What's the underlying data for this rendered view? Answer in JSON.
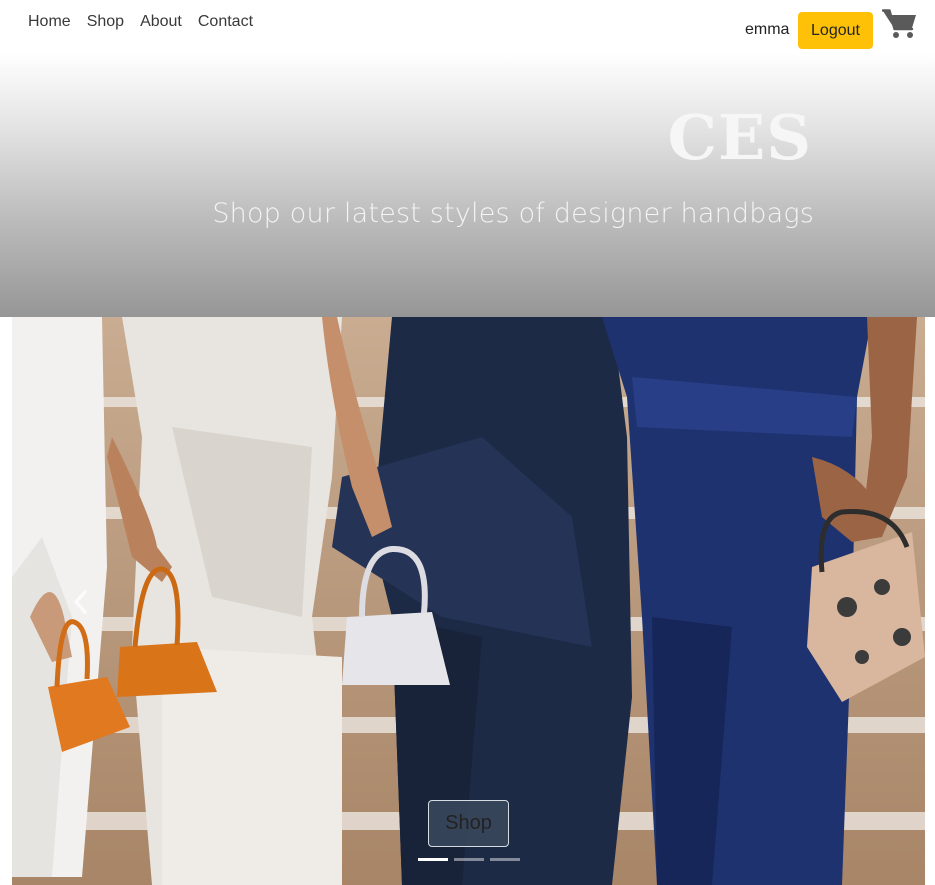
{
  "nav": {
    "links": [
      {
        "label": "Home"
      },
      {
        "label": "Shop"
      },
      {
        "label": "About"
      },
      {
        "label": "Contact"
      }
    ],
    "username": "emma",
    "logout_label": "Logout",
    "cart_icon": "shopping-cart-icon"
  },
  "hero": {
    "title": "CES",
    "subtitle": "Shop our latest styles of designer handbags"
  },
  "carousel": {
    "cta_label": "Shop",
    "prev_icon": "chevron-left-icon",
    "slide_count": 3,
    "active_index": 0
  },
  "colors": {
    "accent": "#ffc107",
    "hero_gradient_top": "#ffffff",
    "hero_gradient_bottom": "#969696"
  }
}
